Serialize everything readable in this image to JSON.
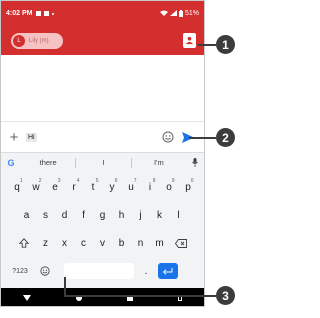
{
  "status_bar": {
    "time": "4:02 PM",
    "battery": "51%"
  },
  "header": {
    "recipient_avatar": "L",
    "recipient_label": "Lily (m)"
  },
  "compose": {
    "message_text": "Hi"
  },
  "suggestions": [
    "there",
    "I",
    "I'm"
  ],
  "keyboard": {
    "row1": [
      {
        "k": "q",
        "n": "1"
      },
      {
        "k": "w",
        "n": "2"
      },
      {
        "k": "e",
        "n": "3"
      },
      {
        "k": "r",
        "n": "4"
      },
      {
        "k": "t",
        "n": "5"
      },
      {
        "k": "y",
        "n": "6"
      },
      {
        "k": "u",
        "n": "7"
      },
      {
        "k": "i",
        "n": "8"
      },
      {
        "k": "o",
        "n": "9"
      },
      {
        "k": "p",
        "n": "0"
      }
    ],
    "row2": [
      "a",
      "s",
      "d",
      "f",
      "g",
      "h",
      "j",
      "k",
      "l"
    ],
    "row3": [
      "z",
      "x",
      "c",
      "v",
      "b",
      "n",
      "m"
    ],
    "symbols_key": "?123",
    "period_key": "."
  },
  "callouts": [
    "1",
    "2",
    "3"
  ],
  "colors": {
    "accent": "#d32f2f",
    "send": "#1a73e8"
  },
  "icons": {
    "add_contact": "add-contact-icon",
    "plus": "plus-icon",
    "emoji": "emoji-icon",
    "send": "send-icon",
    "mic": "mic-icon",
    "shift": "shift-icon",
    "backspace": "backspace-icon"
  }
}
